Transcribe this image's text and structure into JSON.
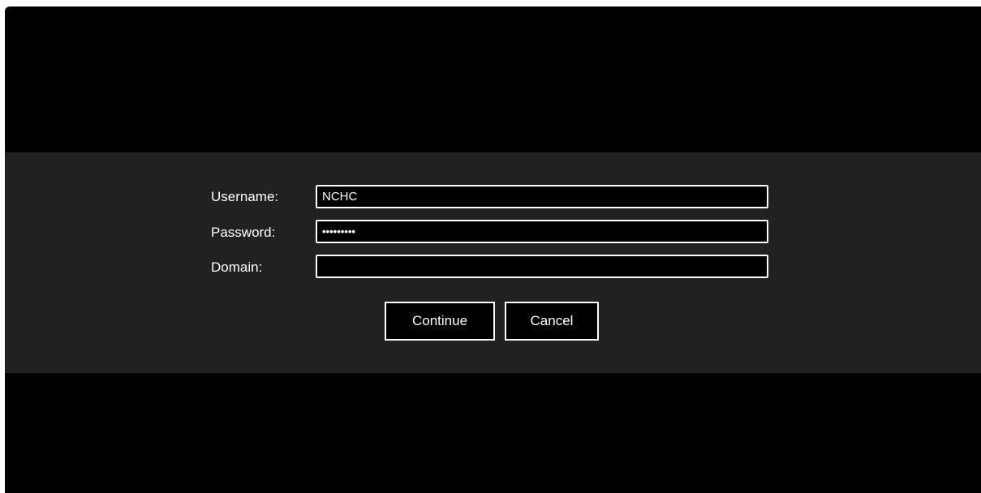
{
  "login": {
    "username_label": "Username:",
    "password_label": "Password:",
    "domain_label": "Domain:",
    "username_value": "NCHC",
    "password_masked": "•••••••••",
    "domain_value": "",
    "continue_label": "Continue",
    "cancel_label": "Cancel"
  },
  "colors": {
    "background": "#000000",
    "panel": "#212121",
    "text": "#ffffff",
    "border": "#ffffff"
  }
}
